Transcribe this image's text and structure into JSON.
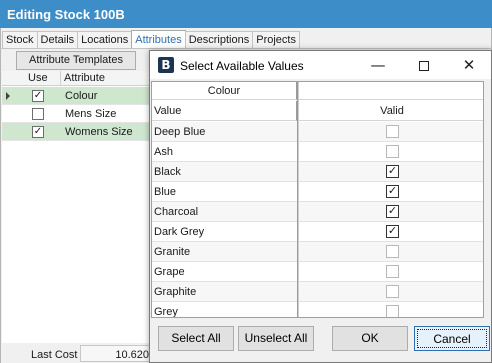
{
  "window": {
    "title": "Editing Stock 100B"
  },
  "tabs": [
    "Stock",
    "Details",
    "Locations",
    "Attributes",
    "Descriptions",
    "Projects"
  ],
  "active_tab": "Attributes",
  "attributes_panel": {
    "templates_button": "Attribute Templates",
    "columns": {
      "use": "Use",
      "attribute": "Attribute"
    },
    "rows": [
      {
        "label": "Colour",
        "checked": true,
        "check_glyph": "✓",
        "selected": true
      },
      {
        "label": "Mens Size",
        "checked": false,
        "check_glyph": "",
        "selected": false
      },
      {
        "label": "Womens Size",
        "checked": true,
        "check_glyph": "✓",
        "selected": true
      }
    ]
  },
  "footer": {
    "last_cost_label": "Last Cost",
    "last_cost_value": "10.620"
  },
  "dialog": {
    "title": "Select Available Values",
    "icon_letter": "B",
    "icon_color": "#1c3552",
    "window_buttons": {
      "minimize": "—",
      "close": "✕"
    },
    "group_header": "Colour",
    "columns": {
      "value": "Value",
      "valid": "Valid"
    },
    "rows": [
      {
        "value": "Deep Blue",
        "valid": false,
        "glyph": ""
      },
      {
        "value": "Ash",
        "valid": false,
        "glyph": ""
      },
      {
        "value": "Black",
        "valid": true,
        "glyph": "✓"
      },
      {
        "value": "Blue",
        "valid": true,
        "glyph": "✓"
      },
      {
        "value": "Charcoal",
        "valid": true,
        "glyph": "✓"
      },
      {
        "value": "Dark Grey",
        "valid": true,
        "glyph": "✓"
      },
      {
        "value": "Granite",
        "valid": false,
        "glyph": ""
      },
      {
        "value": "Grape",
        "valid": false,
        "glyph": ""
      },
      {
        "value": "Graphite",
        "valid": false,
        "glyph": ""
      },
      {
        "value": "Grey",
        "valid": false,
        "glyph": ""
      }
    ],
    "buttons": {
      "select_all": "Select All",
      "unselect_all": "Unselect All",
      "ok": "OK",
      "cancel": "Cancel"
    }
  },
  "colors": {
    "title_bar": "#3c8dc8",
    "selected_row": "#cfe6cf",
    "accent": "#2f6fb0"
  }
}
